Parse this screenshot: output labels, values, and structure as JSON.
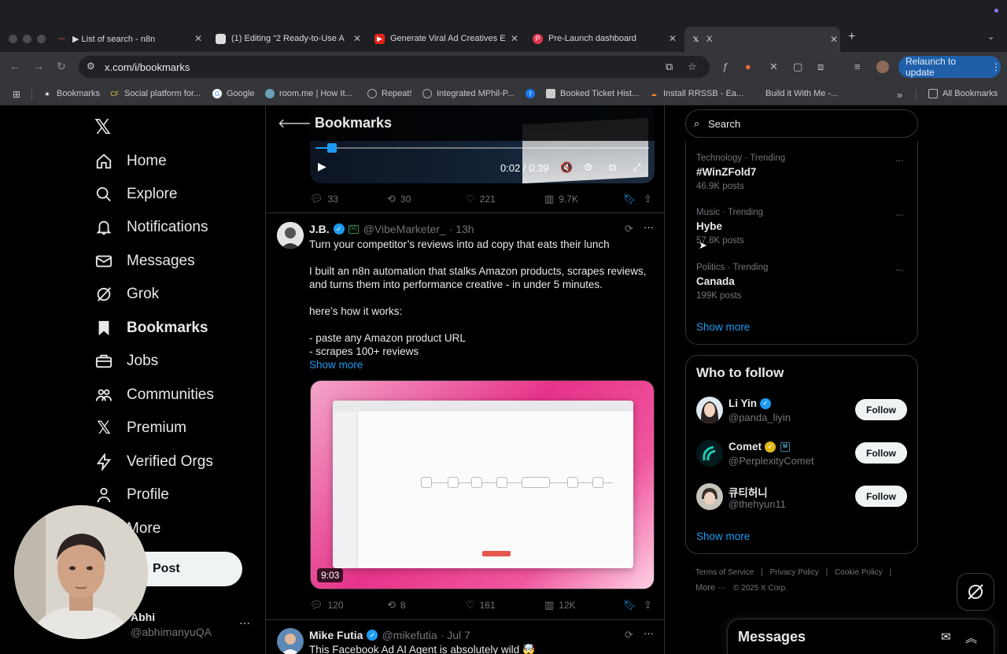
{
  "browser": {
    "tabs": [
      {
        "title": "▶ List of search - n8n"
      },
      {
        "title": "(1) Editing “2 Ready-to-Use A"
      },
      {
        "title": "Generate Viral Ad Creatives E"
      },
      {
        "title": "Pre-Launch dashboard"
      },
      {
        "title": "X"
      }
    ],
    "url": "x.com/i/bookmarks",
    "relaunch_label": "Relaunch to update",
    "bookmarks": [
      "Bookmarks",
      "Social platform for...",
      "Google",
      "room.me | How It...",
      "Repeat!",
      "Integrated MPhil-P...",
      "",
      "Booked Ticket Hist...",
      "Install RRSSB - Ea...",
      "Build it With Me -..."
    ],
    "all_bookmarks": "All Bookmarks"
  },
  "nav": {
    "items": [
      {
        "label": "Home",
        "icon": "home-icon"
      },
      {
        "label": "Explore",
        "icon": "search-icon"
      },
      {
        "label": "Notifications",
        "icon": "bell-icon"
      },
      {
        "label": "Messages",
        "icon": "envelope-icon"
      },
      {
        "label": "Grok",
        "icon": "grok-icon"
      },
      {
        "label": "Bookmarks",
        "icon": "bookmark-icon"
      },
      {
        "label": "Jobs",
        "icon": "briefcase-icon"
      },
      {
        "label": "Communities",
        "icon": "people-icon"
      },
      {
        "label": "Premium",
        "icon": "x-icon"
      },
      {
        "label": "Verified Orgs",
        "icon": "lightning-icon"
      },
      {
        "label": "Profile",
        "icon": "person-icon"
      },
      {
        "label": "More",
        "icon": "more-icon"
      }
    ],
    "post_label": "Post",
    "account": {
      "name": "Abhi",
      "handle": "@abhimanyuQA"
    }
  },
  "main": {
    "title": "Bookmarks",
    "tweet1": {
      "video_time": "0:02 / 0:39",
      "replies": "33",
      "reposts": "30",
      "likes": "221",
      "views": "9.7K",
      "progress": 0.05
    },
    "tweet2": {
      "name": "J.B.",
      "handle": "@VibeMarketer_",
      "time": "· 13h",
      "lines": [
        "Turn your competitor’s reviews into ad copy that eats their lunch",
        "I built an n8n automation that stalks Amazon products, scrapes reviews,",
        "and turns them into performance creative - in under 5 minutes.",
        "here’s how it works:",
        "- paste any Amazon product URL",
        "- scrapes 100+ reviews"
      ],
      "show_more": "Show more",
      "video_duration": "9:03",
      "replies": "120",
      "reposts": "8",
      "likes": "161",
      "views": "12K"
    },
    "tweet3": {
      "name": "Mike Futia",
      "handle": "@mikefutia",
      "time": "· Jul 7",
      "text": "This Facebook Ad AI Agent is absolutely wild 🤯"
    }
  },
  "right": {
    "search_placeholder": "Search",
    "trends": [
      {
        "meta": "Technology · Trending",
        "name": "#WinZFold7",
        "count": "46.9K posts"
      },
      {
        "meta": "Music · Trending",
        "name": "Hybe",
        "count": "57.8K posts"
      },
      {
        "meta": "Politics · Trending",
        "name": "Canada",
        "count": "199K posts"
      }
    ],
    "trends_show_more": "Show more",
    "who_to_follow": {
      "title": "Who to follow",
      "accounts": [
        {
          "name": "Li Yin",
          "handle": "@panda_liyin"
        },
        {
          "name": "Comet",
          "handle": "@PerplexityComet"
        },
        {
          "name": "큐티허니",
          "handle": "@thehyun11"
        }
      ],
      "follow_label": "Follow",
      "show_more": "Show more"
    },
    "footer": {
      "links": [
        "Terms of Service",
        "Privacy Policy",
        "Cookie Policy"
      ],
      "more": "More ···",
      "copyright": "© 2025 X Corp."
    },
    "messages_title": "Messages"
  },
  "colors": {
    "accent": "#1d9bf0",
    "background": "#000000",
    "border": "#2f3336",
    "muted": "#71767b"
  }
}
